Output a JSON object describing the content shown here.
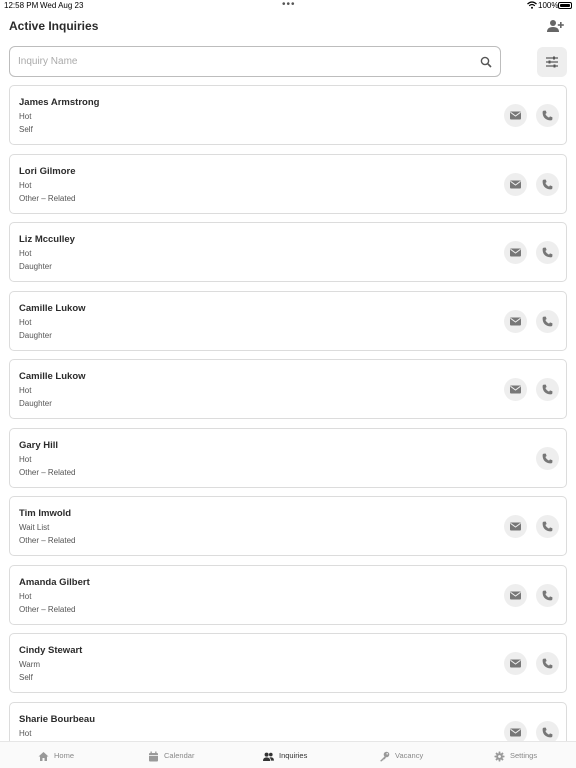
{
  "status_bar": {
    "time": "12:58 PM",
    "date": "Wed Aug 23",
    "battery": "100%"
  },
  "header": {
    "title": "Active Inquiries",
    "add_icon": "add-user-icon"
  },
  "search": {
    "placeholder": "Inquiry Name",
    "value": "",
    "icon": "search-icon",
    "filter_icon": "sliders-icon"
  },
  "inquiries": [
    {
      "name": "James Armstrong",
      "status": "Hot",
      "relation": "Self",
      "has_email": true
    },
    {
      "name": "Lori Gilmore",
      "status": "Hot",
      "relation": "Other – Related",
      "has_email": true
    },
    {
      "name": "Liz Mcculley",
      "status": "Hot",
      "relation": "Daughter",
      "has_email": true
    },
    {
      "name": "Camille Lukow",
      "status": "Hot",
      "relation": "Daughter",
      "has_email": true
    },
    {
      "name": "Camille Lukow",
      "status": "Hot",
      "relation": "Daughter",
      "has_email": true
    },
    {
      "name": "Gary Hill",
      "status": "Hot",
      "relation": "Other – Related",
      "has_email": false
    },
    {
      "name": "Tim Imwold",
      "status": "Wait List",
      "relation": "Other – Related",
      "has_email": true
    },
    {
      "name": "Amanda Gilbert",
      "status": "Hot",
      "relation": "Other – Related",
      "has_email": true
    },
    {
      "name": "Cindy Stewart",
      "status": "Warm",
      "relation": "Self",
      "has_email": true
    },
    {
      "name": "Sharie Bourbeau",
      "status": "Hot",
      "relation": "",
      "has_email": true
    }
  ],
  "tabs": [
    {
      "label": "Home",
      "icon": "home-icon",
      "active": false
    },
    {
      "label": "Calendar",
      "icon": "calendar-icon",
      "active": false
    },
    {
      "label": "Inquiries",
      "icon": "users-icon",
      "active": true
    },
    {
      "label": "Vacancy",
      "icon": "key-icon",
      "active": false
    },
    {
      "label": "Settings",
      "icon": "gear-icon",
      "active": false
    }
  ],
  "colors": {
    "button_bg": "#eeeeee",
    "icon_gray": "#777777",
    "tab_inactive": "#888888",
    "tab_active": "#333333"
  }
}
